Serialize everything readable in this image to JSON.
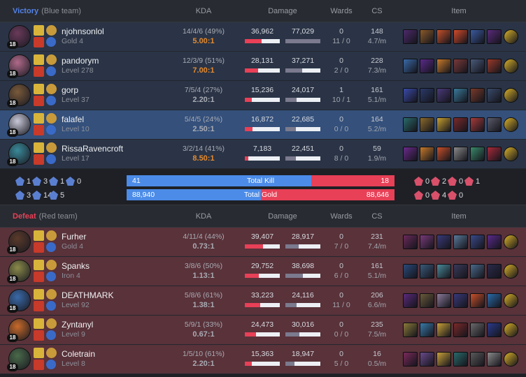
{
  "colors": {
    "blue": "#5383e8",
    "red": "#e84057",
    "kda_high": "#e58a2e"
  },
  "headers": {
    "kda": "KDA",
    "damage": "Damage",
    "wards": "Wards",
    "cs": "CS",
    "item": "Item"
  },
  "blue": {
    "result": "Victory",
    "team": "(Blue team)",
    "players": [
      {
        "name": "njohnsonlol",
        "sub": "Gold 4",
        "level": "18",
        "kda_line": "14/4/6 (49%)",
        "kda": "5.00:1",
        "kda_hi": true,
        "dealt": "36,962",
        "taken": "77,029",
        "dealt_frac": 0.47,
        "taken_frac": 1.0,
        "wards": "0",
        "wards_line": "11 / 0",
        "cs": "148",
        "cs_min": "4.7/m",
        "me": false,
        "champ_color": "#6a3a5a",
        "items": [
          "#4d2a6a",
          "#8a5a2a",
          "#c4502a",
          "#d24a2a",
          "#3a5aa0",
          "#5a2a7a",
          "#d8b02a"
        ]
      },
      {
        "name": "pandorym",
        "sub": "Level 278",
        "level": "18",
        "kda_line": "12/3/9 (51%)",
        "kda": "7.00:1",
        "kda_hi": true,
        "dealt": "28,131",
        "taken": "37,271",
        "dealt_frac": 0.37,
        "taken_frac": 0.48,
        "wards": "0",
        "wards_line": "2 / 0",
        "cs": "228",
        "cs_min": "7.3/m",
        "me": false,
        "champ_color": "#b06a8a",
        "items": [
          "#3a6aa8",
          "#5a2a8a",
          "#c87a2a",
          "#7a3a3a",
          "#4a5a7a",
          "#9a3a2a",
          "#d8b02a"
        ]
      },
      {
        "name": "gorp",
        "sub": "Level 37",
        "level": "18",
        "kda_line": "7/5/4 (27%)",
        "kda": "2.20:1",
        "kda_hi": false,
        "dealt": "15,236",
        "taken": "24,017",
        "dealt_frac": 0.2,
        "taken_frac": 0.31,
        "wards": "1",
        "wards_line": "10 / 1",
        "cs": "161",
        "cs_min": "5.1/m",
        "me": false,
        "champ_color": "#7a5a3a",
        "items": [
          "#3a4aa8",
          "#2a3a6a",
          "#4a3a7a",
          "#3a7a9a",
          "#7a3a2a",
          "#3a4a6a",
          "#d8b02a"
        ]
      },
      {
        "name": "falafel",
        "sub": "Level 10",
        "level": "18",
        "kda_line": "5/4/5 (24%)",
        "kda": "2.50:1",
        "kda_hi": false,
        "dealt": "16,872",
        "taken": "22,685",
        "dealt_frac": 0.22,
        "taken_frac": 0.29,
        "wards": "0",
        "wards_line": "0 / 0",
        "cs": "164",
        "cs_min": "5.2/m",
        "me": true,
        "champ_color": "#c8c8d8",
        "items": [
          "#2a6a6a",
          "#8a6a2a",
          "#c8a030",
          "#7a2a2a",
          "#a83a3a",
          "#5a5a6a",
          "#d8b02a"
        ]
      },
      {
        "name": "RissaRavencroft",
        "sub": "Level 17",
        "level": "18",
        "kda_line": "3/2/14 (41%)",
        "kda": "8.50:1",
        "kda_hi": true,
        "dealt": "7,183",
        "taken": "22,451",
        "dealt_frac": 0.1,
        "taken_frac": 0.29,
        "wards": "0",
        "wards_line": "8 / 0",
        "cs": "59",
        "cs_min": "1.9/m",
        "me": false,
        "champ_color": "#3a8a9a",
        "items": [
          "#6a2a8a",
          "#c87a2a",
          "#c8502a",
          "#8a8a8a",
          "#3a8a6a",
          "#a82a3a",
          "#d8b02a"
        ]
      }
    ]
  },
  "summary": {
    "blue_obj": [
      {
        "v": "1",
        "c": "#5b7fd0"
      },
      {
        "v": "3",
        "c": "#5b7fd0"
      },
      {
        "v": "1",
        "c": "#5b7fd0"
      },
      {
        "v": "0",
        "c": "#5b7fd0"
      }
    ],
    "blue_obj2": [
      {
        "v": "3",
        "c": "#5b7fd0"
      },
      {
        "v": "14",
        "c": "#5b7fd0"
      },
      {
        "v": "5",
        "c": "#5b7fd0"
      }
    ],
    "red_obj": [
      {
        "v": "0",
        "c": "#d8506a"
      },
      {
        "v": "2",
        "c": "#d8506a"
      },
      {
        "v": "0",
        "c": "#d8506a"
      },
      {
        "v": "1",
        "c": "#d8506a"
      }
    ],
    "red_obj2": [
      {
        "v": "0",
        "c": "#d8506a"
      },
      {
        "v": "4",
        "c": "#d8506a"
      },
      {
        "v": "0",
        "c": "#d8506a"
      }
    ],
    "kill_label": "Total Kill",
    "blue_kills": "41",
    "red_kills": "18",
    "kill_frac": 0.69,
    "gold_label_a": "Total",
    "gold_label_b": "Gold",
    "blue_gold": "88,940",
    "red_gold": "88,646",
    "gold_frac": 0.5
  },
  "red": {
    "result": "Defeat",
    "team": "(Red team)",
    "players": [
      {
        "name": "Furher",
        "sub": "Gold 4",
        "level": "18",
        "kda_line": "4/11/4 (44%)",
        "kda": "0.73:1",
        "kda_hi": false,
        "dealt": "39,407",
        "taken": "28,917",
        "dealt_frac": 0.51,
        "taken_frac": 0.38,
        "wards": "0",
        "wards_line": "7 / 0",
        "cs": "231",
        "cs_min": "7.4/m",
        "me": false,
        "champ_color": "#5a3a2a",
        "items": [
          "#6a2a5a",
          "#7a3a7a",
          "#3a3a7a",
          "#5a7a9a",
          "#3a4a8a",
          "#5a2a8a",
          "#d8b02a"
        ]
      },
      {
        "name": "Spanks",
        "sub": "Iron 4",
        "level": "18",
        "kda_line": "3/8/6 (50%)",
        "kda": "1.13:1",
        "kda_hi": false,
        "dealt": "29,752",
        "taken": "38,698",
        "dealt_frac": 0.39,
        "taken_frac": 0.5,
        "wards": "0",
        "wards_line": "6 / 0",
        "cs": "161",
        "cs_min": "5.1/m",
        "me": false,
        "champ_color": "#8a8a4a",
        "items": [
          "#2a4a7a",
          "#3a5a7a",
          "#4a8a9a",
          "#3a3a5a",
          "#4a6a8a",
          "#2a2a4a",
          "#d8b02a"
        ]
      },
      {
        "name": "DEATHMARK",
        "sub": "Level 92",
        "level": "18",
        "kda_line": "5/8/6 (61%)",
        "kda": "1.38:1",
        "kda_hi": false,
        "dealt": "33,223",
        "taken": "24,116",
        "dealt_frac": 0.43,
        "taken_frac": 0.31,
        "wards": "0",
        "wards_line": "11 / 0",
        "cs": "206",
        "cs_min": "6.6/m",
        "me": false,
        "champ_color": "#3a6aa8",
        "items": [
          "#5a2a7a",
          "#6a5a3a",
          "#8a7a9a",
          "#3a3a7a",
          "#c8502a",
          "#2a6aa8",
          "#d8b02a"
        ]
      },
      {
        "name": "Zyntanyl",
        "sub": "Level 9",
        "level": "18",
        "kda_line": "5/9/1 (33%)",
        "kda": "0.67:1",
        "kda_hi": false,
        "dealt": "24,473",
        "taken": "30,016",
        "dealt_frac": 0.32,
        "taken_frac": 0.39,
        "wards": "0",
        "wards_line": "0 / 0",
        "cs": "235",
        "cs_min": "7.5/m",
        "me": false,
        "champ_color": "#c86a2a",
        "items": [
          "#8a7a3a",
          "#3a7aa8",
          "#c8a03a",
          "#7a2a2a",
          "#6a6a6a",
          "#2a3a8a",
          "#d8b02a"
        ]
      },
      {
        "name": "Coletrain",
        "sub": "Level 8",
        "level": "18",
        "kda_line": "1/5/10 (61%)",
        "kda": "2.20:1",
        "kda_hi": false,
        "dealt": "15,363",
        "taken": "18,947",
        "dealt_frac": 0.2,
        "taken_frac": 0.25,
        "wards": "0",
        "wards_line": "5 / 0",
        "cs": "16",
        "cs_min": "0.5/m",
        "me": false,
        "champ_color": "#4a6a4a",
        "items": [
          "#7a2a5a",
          "#6a4a8a",
          "#c8a03a",
          "#2a6a6a",
          "#5a5a5a",
          "#8a8a8a",
          "#d8b02a"
        ]
      }
    ]
  }
}
